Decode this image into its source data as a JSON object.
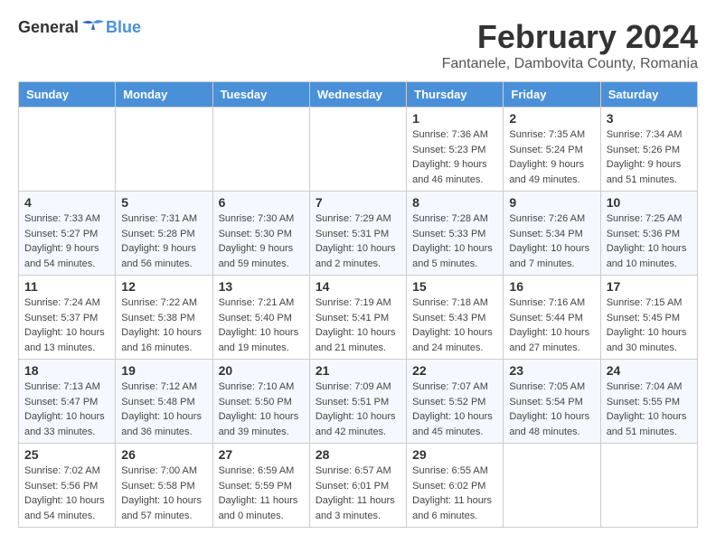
{
  "header": {
    "logo_general": "General",
    "logo_blue": "Blue",
    "month_title": "February 2024",
    "location": "Fantanele, Dambovita County, Romania"
  },
  "days_of_week": [
    "Sunday",
    "Monday",
    "Tuesday",
    "Wednesday",
    "Thursday",
    "Friday",
    "Saturday"
  ],
  "weeks": [
    [
      {
        "day": "",
        "info": ""
      },
      {
        "day": "",
        "info": ""
      },
      {
        "day": "",
        "info": ""
      },
      {
        "day": "",
        "info": ""
      },
      {
        "day": "1",
        "info": "Sunrise: 7:36 AM\nSunset: 5:23 PM\nDaylight: 9 hours\nand 46 minutes."
      },
      {
        "day": "2",
        "info": "Sunrise: 7:35 AM\nSunset: 5:24 PM\nDaylight: 9 hours\nand 49 minutes."
      },
      {
        "day": "3",
        "info": "Sunrise: 7:34 AM\nSunset: 5:26 PM\nDaylight: 9 hours\nand 51 minutes."
      }
    ],
    [
      {
        "day": "4",
        "info": "Sunrise: 7:33 AM\nSunset: 5:27 PM\nDaylight: 9 hours\nand 54 minutes."
      },
      {
        "day": "5",
        "info": "Sunrise: 7:31 AM\nSunset: 5:28 PM\nDaylight: 9 hours\nand 56 minutes."
      },
      {
        "day": "6",
        "info": "Sunrise: 7:30 AM\nSunset: 5:30 PM\nDaylight: 9 hours\nand 59 minutes."
      },
      {
        "day": "7",
        "info": "Sunrise: 7:29 AM\nSunset: 5:31 PM\nDaylight: 10 hours\nand 2 minutes."
      },
      {
        "day": "8",
        "info": "Sunrise: 7:28 AM\nSunset: 5:33 PM\nDaylight: 10 hours\nand 5 minutes."
      },
      {
        "day": "9",
        "info": "Sunrise: 7:26 AM\nSunset: 5:34 PM\nDaylight: 10 hours\nand 7 minutes."
      },
      {
        "day": "10",
        "info": "Sunrise: 7:25 AM\nSunset: 5:36 PM\nDaylight: 10 hours\nand 10 minutes."
      }
    ],
    [
      {
        "day": "11",
        "info": "Sunrise: 7:24 AM\nSunset: 5:37 PM\nDaylight: 10 hours\nand 13 minutes."
      },
      {
        "day": "12",
        "info": "Sunrise: 7:22 AM\nSunset: 5:38 PM\nDaylight: 10 hours\nand 16 minutes."
      },
      {
        "day": "13",
        "info": "Sunrise: 7:21 AM\nSunset: 5:40 PM\nDaylight: 10 hours\nand 19 minutes."
      },
      {
        "day": "14",
        "info": "Sunrise: 7:19 AM\nSunset: 5:41 PM\nDaylight: 10 hours\nand 21 minutes."
      },
      {
        "day": "15",
        "info": "Sunrise: 7:18 AM\nSunset: 5:43 PM\nDaylight: 10 hours\nand 24 minutes."
      },
      {
        "day": "16",
        "info": "Sunrise: 7:16 AM\nSunset: 5:44 PM\nDaylight: 10 hours\nand 27 minutes."
      },
      {
        "day": "17",
        "info": "Sunrise: 7:15 AM\nSunset: 5:45 PM\nDaylight: 10 hours\nand 30 minutes."
      }
    ],
    [
      {
        "day": "18",
        "info": "Sunrise: 7:13 AM\nSunset: 5:47 PM\nDaylight: 10 hours\nand 33 minutes."
      },
      {
        "day": "19",
        "info": "Sunrise: 7:12 AM\nSunset: 5:48 PM\nDaylight: 10 hours\nand 36 minutes."
      },
      {
        "day": "20",
        "info": "Sunrise: 7:10 AM\nSunset: 5:50 PM\nDaylight: 10 hours\nand 39 minutes."
      },
      {
        "day": "21",
        "info": "Sunrise: 7:09 AM\nSunset: 5:51 PM\nDaylight: 10 hours\nand 42 minutes."
      },
      {
        "day": "22",
        "info": "Sunrise: 7:07 AM\nSunset: 5:52 PM\nDaylight: 10 hours\nand 45 minutes."
      },
      {
        "day": "23",
        "info": "Sunrise: 7:05 AM\nSunset: 5:54 PM\nDaylight: 10 hours\nand 48 minutes."
      },
      {
        "day": "24",
        "info": "Sunrise: 7:04 AM\nSunset: 5:55 PM\nDaylight: 10 hours\nand 51 minutes."
      }
    ],
    [
      {
        "day": "25",
        "info": "Sunrise: 7:02 AM\nSunset: 5:56 PM\nDaylight: 10 hours\nand 54 minutes."
      },
      {
        "day": "26",
        "info": "Sunrise: 7:00 AM\nSunset: 5:58 PM\nDaylight: 10 hours\nand 57 minutes."
      },
      {
        "day": "27",
        "info": "Sunrise: 6:59 AM\nSunset: 5:59 PM\nDaylight: 11 hours\nand 0 minutes."
      },
      {
        "day": "28",
        "info": "Sunrise: 6:57 AM\nSunset: 6:01 PM\nDaylight: 11 hours\nand 3 minutes."
      },
      {
        "day": "29",
        "info": "Sunrise: 6:55 AM\nSunset: 6:02 PM\nDaylight: 11 hours\nand 6 minutes."
      },
      {
        "day": "",
        "info": ""
      },
      {
        "day": "",
        "info": ""
      }
    ]
  ]
}
